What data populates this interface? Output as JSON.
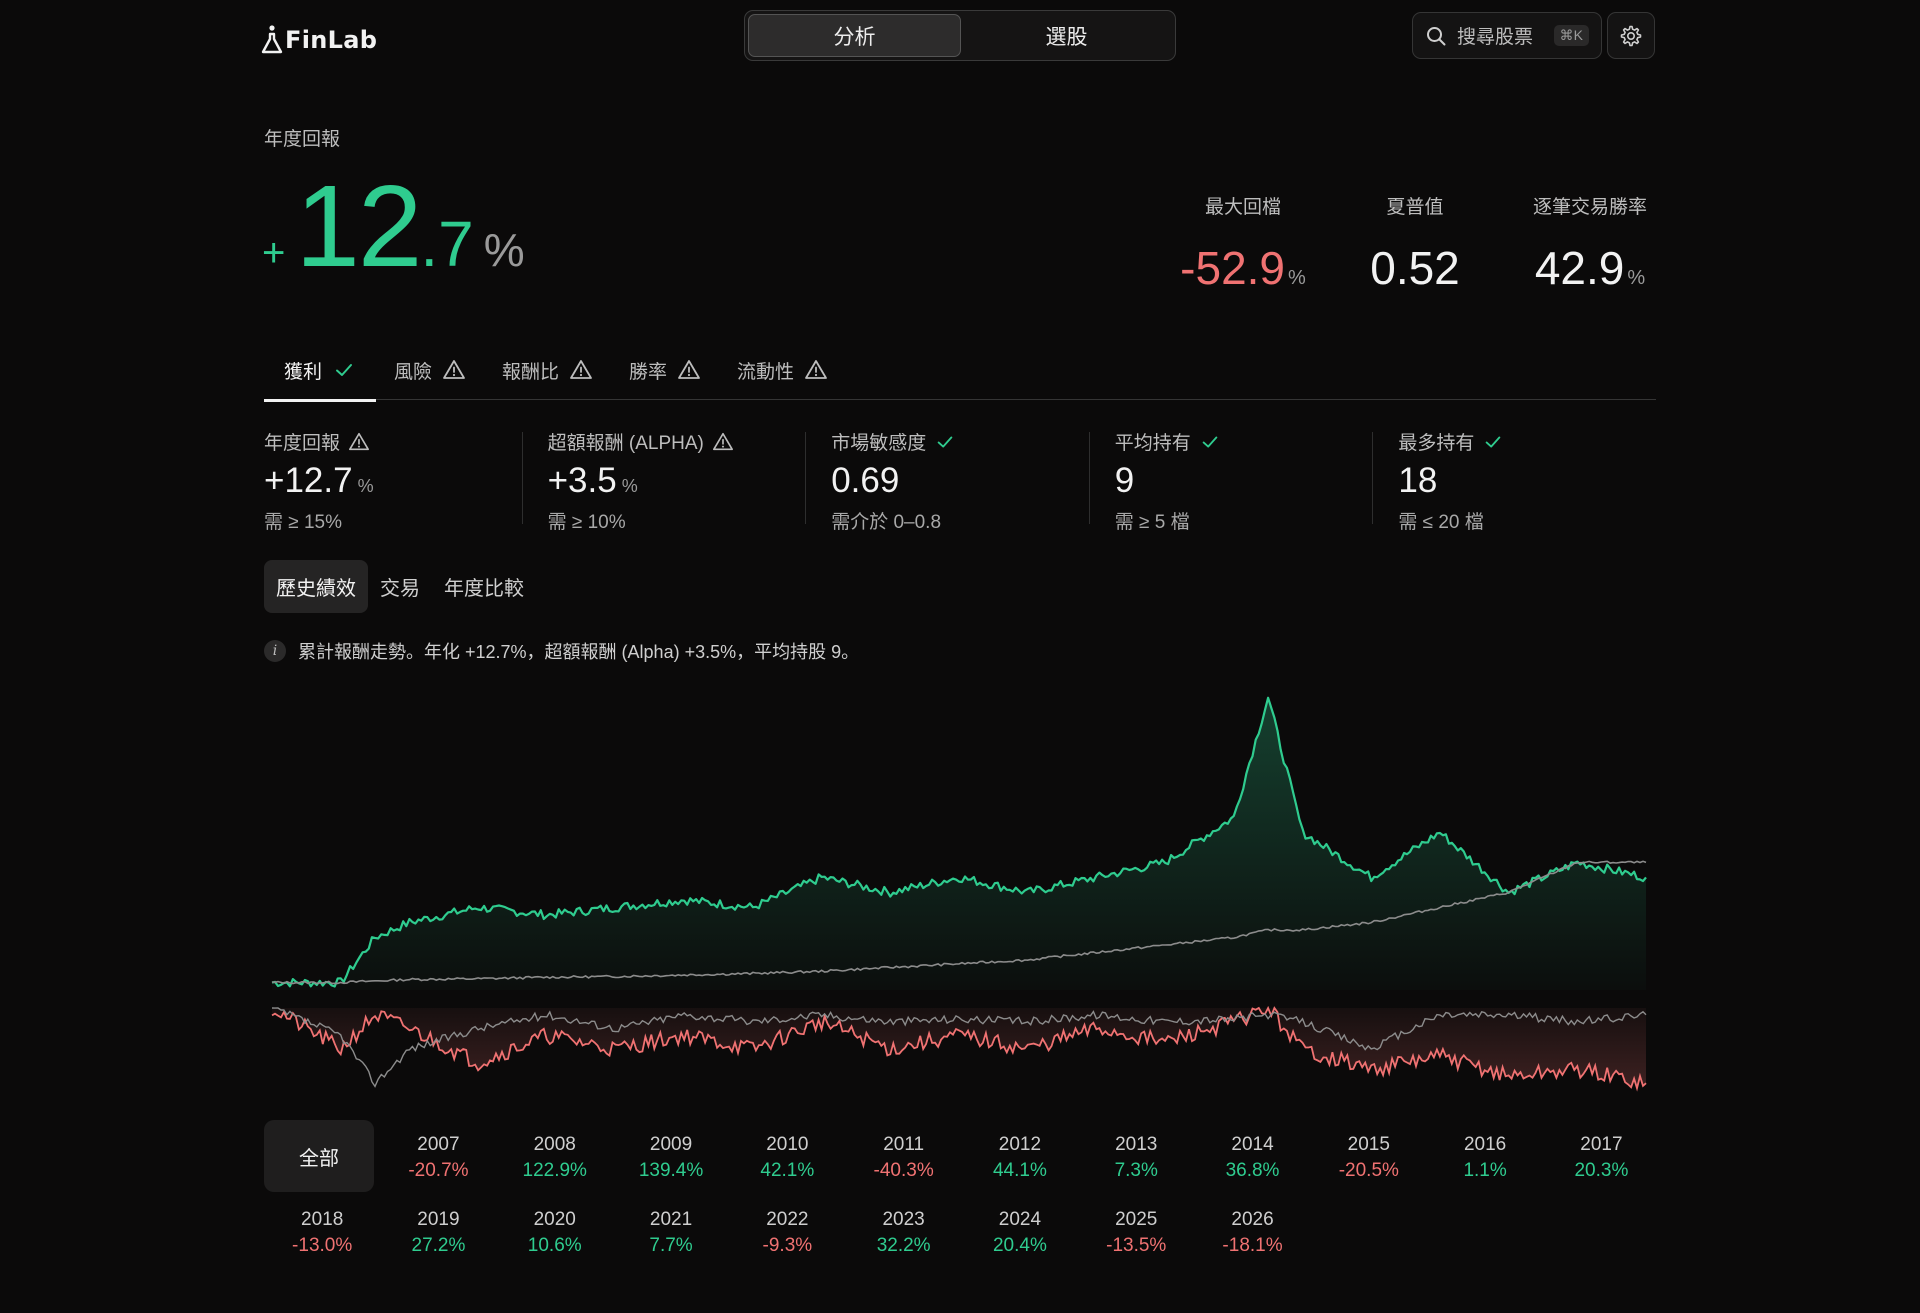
{
  "brand": {
    "name": "FinLab"
  },
  "mode_switch": {
    "items": [
      "分析",
      "選股"
    ],
    "active": 0
  },
  "search": {
    "label": "搜尋股票",
    "shortcut": "⌘K"
  },
  "hero": {
    "label": "年度回報",
    "sign": "+",
    "int": "12",
    "dec": ".7",
    "unit": "%"
  },
  "kpis": [
    {
      "label": "最大回檔",
      "value": "-52.9",
      "unit": "%",
      "negative": true
    },
    {
      "label": "夏普值",
      "value": "0.52",
      "unit": ""
    },
    {
      "label": "逐筆交易勝率",
      "value": "42.9",
      "unit": "%"
    }
  ],
  "tabs": [
    {
      "label": "獲利",
      "status": "check",
      "active": true
    },
    {
      "label": "風險",
      "status": "warn"
    },
    {
      "label": "報酬比",
      "status": "warn"
    },
    {
      "label": "勝率",
      "status": "warn"
    },
    {
      "label": "流動性",
      "status": "warn"
    }
  ],
  "metrics": [
    {
      "label": "年度回報",
      "status": "warn",
      "value": "+12.7",
      "unit": "%",
      "req": "需 ≥ 15%"
    },
    {
      "label": "超額報酬 (ALPHA)",
      "status": "warn",
      "value": "+3.5",
      "unit": "%",
      "req": "需 ≥ 10%"
    },
    {
      "label": "市場敏感度",
      "status": "check",
      "value": "0.69",
      "unit": "",
      "req": "需介於 0–0.8"
    },
    {
      "label": "平均持有",
      "status": "check",
      "value": "9",
      "unit": "",
      "req": "需 ≥ 5 檔"
    },
    {
      "label": "最多持有",
      "status": "check",
      "value": "18",
      "unit": "",
      "req": "需 ≤ 20 檔"
    }
  ],
  "subtabs": {
    "items": [
      "歷史績效",
      "交易",
      "年度比較"
    ],
    "active": 0
  },
  "note": {
    "icon": "i",
    "text": "累計報酬走勢。年化 +12.7%，超額報酬 (Alpha) +3.5%，平均持股 9。"
  },
  "colors": {
    "positive": "#2fcc8f",
    "negative": "#f07272",
    "benchmark": "#8c8c8c"
  },
  "chart_data": {
    "type": "line",
    "x": [
      2006,
      2007,
      2007.5,
      2008,
      2009,
      2010,
      2011,
      2012,
      2013,
      2014,
      2015,
      2016,
      2017,
      2018,
      2019,
      2020,
      2020.5,
      2021,
      2022,
      2023,
      2024,
      2025,
      2026
    ],
    "series": [
      {
        "values": [
          1.0,
          1.0,
          1.6,
          1.8,
          2.0,
          1.9,
          2.0,
          2.1,
          2.0,
          2.4,
          2.2,
          2.4,
          2.2,
          2.4,
          2.6,
          3.2,
          4.8,
          3.0,
          2.4,
          3.0,
          2.2,
          2.6,
          2.4
        ]
      },
      {
        "values": [
          1.0,
          1.0,
          1.02,
          1.04,
          1.05,
          1.07,
          1.08,
          1.1,
          1.12,
          1.15,
          1.2,
          1.25,
          1.3,
          1.4,
          1.5,
          1.6,
          1.7,
          1.7,
          1.8,
          2.0,
          2.2,
          2.6,
          2.6
        ]
      }
    ],
    "drawdown": {
      "x": [
        2006,
        2007,
        2007.5,
        2008,
        2009,
        2010,
        2011,
        2012,
        2013,
        2014,
        2015,
        2016,
        2017,
        2018,
        2019,
        2020,
        2020.5,
        2021,
        2022,
        2023,
        2024,
        2025,
        2026
      ],
      "series": [
        {
          "values": [
            0,
            -0.3,
            -0.05,
            -0.15,
            -0.4,
            -0.2,
            -0.3,
            -0.2,
            -0.3,
            -0.1,
            -0.3,
            -0.2,
            -0.3,
            -0.15,
            -0.25,
            -0.1,
            0,
            -0.3,
            -0.45,
            -0.35,
            -0.5,
            -0.45,
            -0.55
          ]
        },
        {
          "values": [
            0,
            -0.2,
            -0.55,
            -0.3,
            -0.15,
            -0.05,
            -0.15,
            -0.05,
            -0.1,
            -0.05,
            -0.1,
            -0.08,
            -0.1,
            -0.05,
            -0.1,
            -0.08,
            -0.05,
            -0.1,
            -0.3,
            -0.05,
            -0.05,
            -0.1,
            -0.05
          ]
        }
      ]
    }
  },
  "years": {
    "all_label": "全部",
    "items": [
      {
        "year": "2007",
        "ret": "-20.7%",
        "neg": true
      },
      {
        "year": "2008",
        "ret": "122.9%"
      },
      {
        "year": "2009",
        "ret": "139.4%"
      },
      {
        "year": "2010",
        "ret": "42.1%"
      },
      {
        "year": "2011",
        "ret": "-40.3%",
        "neg": true
      },
      {
        "year": "2012",
        "ret": "44.1%"
      },
      {
        "year": "2013",
        "ret": "7.3%"
      },
      {
        "year": "2014",
        "ret": "36.8%"
      },
      {
        "year": "2015",
        "ret": "-20.5%",
        "neg": true
      },
      {
        "year": "2016",
        "ret": "1.1%"
      },
      {
        "year": "2017",
        "ret": "20.3%"
      },
      {
        "year": "2018",
        "ret": "-13.0%",
        "neg": true
      },
      {
        "year": "2019",
        "ret": "27.2%"
      },
      {
        "year": "2020",
        "ret": "10.6%"
      },
      {
        "year": "2021",
        "ret": "7.7%"
      },
      {
        "year": "2022",
        "ret": "-9.3%",
        "neg": true
      },
      {
        "year": "2023",
        "ret": "32.2%"
      },
      {
        "year": "2024",
        "ret": "20.4%"
      },
      {
        "year": "2025",
        "ret": "-13.5%",
        "neg": true
      },
      {
        "year": "2026",
        "ret": "-18.1%",
        "neg": true
      }
    ]
  }
}
